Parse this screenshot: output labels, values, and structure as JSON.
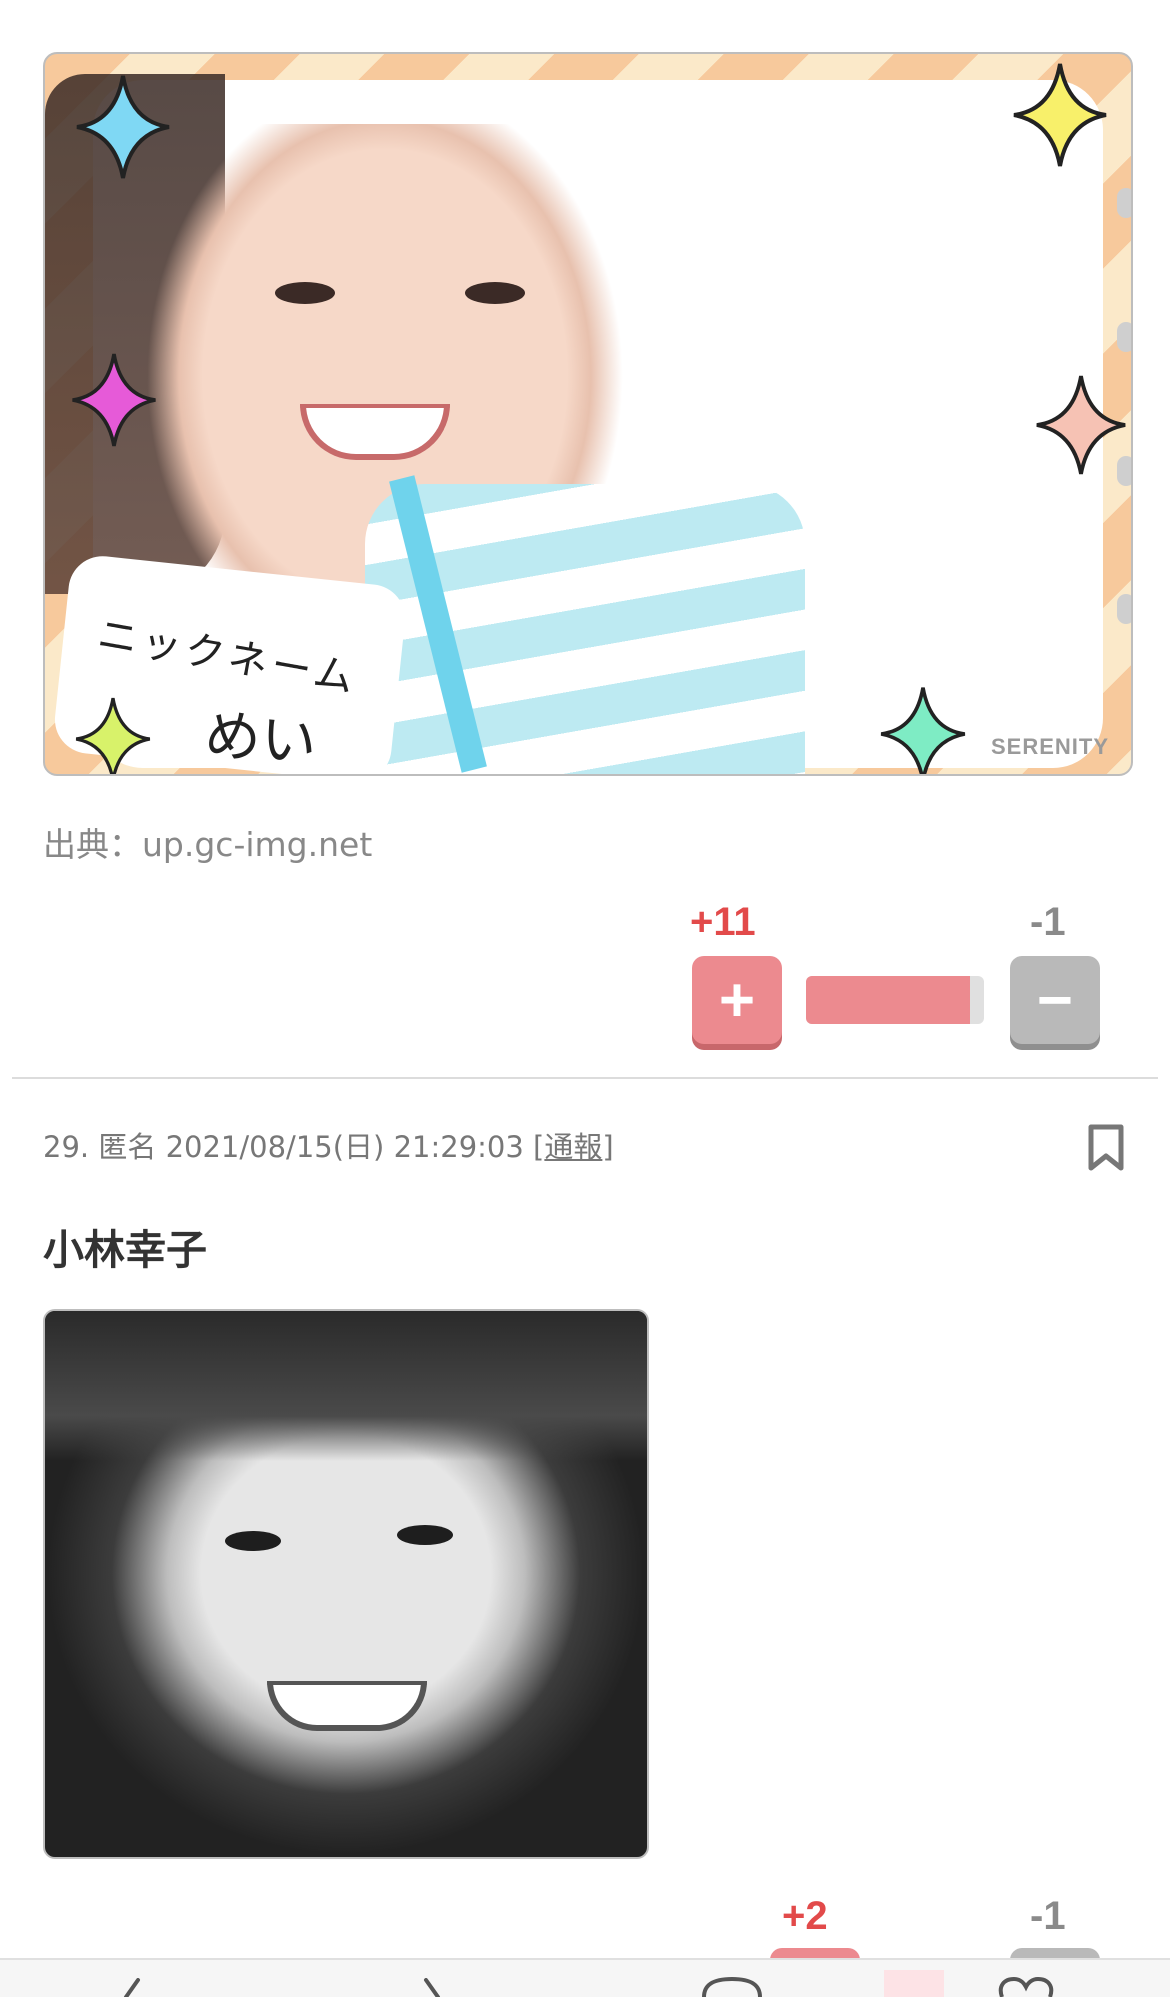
{
  "post28": {
    "image": {
      "nickname_label": "ニックネーム",
      "nickname": "めい",
      "watermark": "SERENITY"
    },
    "source_label": "出典：up.gc-img.net",
    "votes": {
      "plus": "+11",
      "minus": "-1",
      "plus_ratio": 0.92,
      "plus_symbol": "+",
      "minus_symbol": "−"
    }
  },
  "post29": {
    "number": "29.",
    "author": "匿名",
    "datetime": "2021/08/15(日) 21:29:03",
    "report_open": "[",
    "report_label": "通報",
    "report_close": "]",
    "body": "小林幸子",
    "votes": {
      "plus": "+2",
      "minus": "-1"
    }
  },
  "icons": {
    "bookmark": "bookmark-icon",
    "back": "chevron-left-icon",
    "forward": "chevron-right-icon",
    "comment": "comment-icon",
    "favorite": "heart-icon"
  },
  "colors": {
    "plus_accent": "#e24a4a",
    "plus_button": "#ec8a8f",
    "minus_button": "#b9b9b9"
  }
}
